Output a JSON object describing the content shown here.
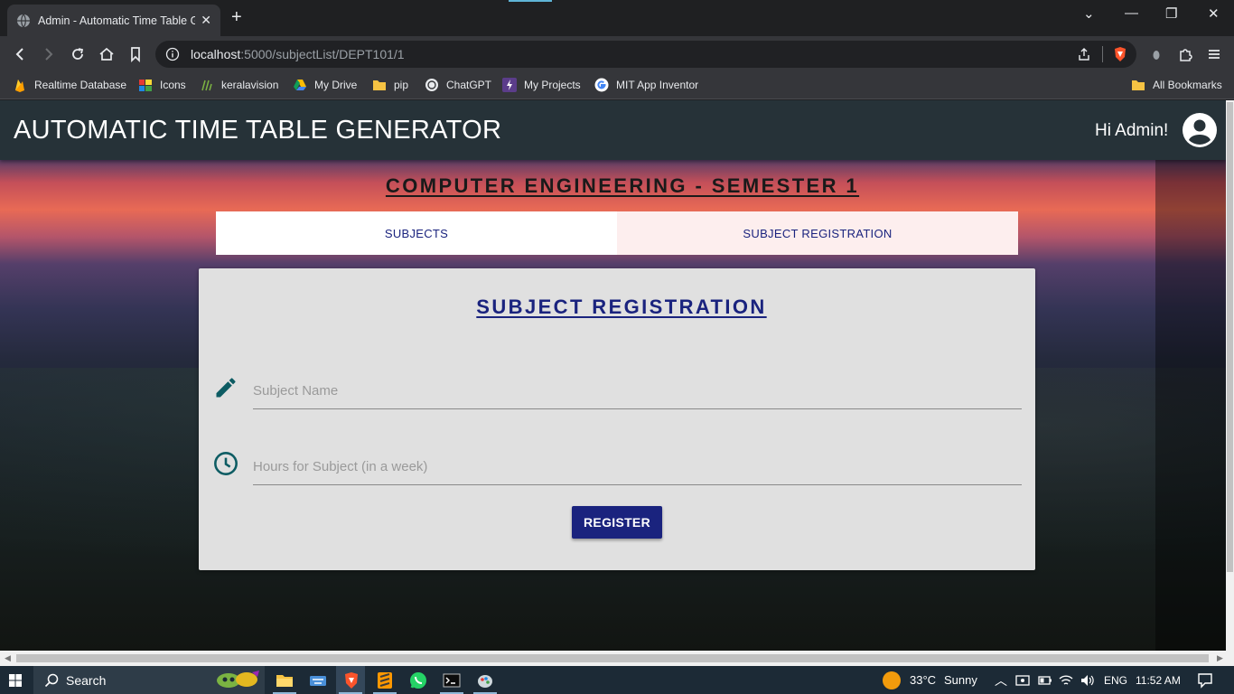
{
  "browser": {
    "tab_title": "Admin - Automatic Time Table G",
    "url_host": "localhost",
    "url_path": ":5000/subjectList/DEPT101/1",
    "bookmarks": [
      {
        "label": "Realtime Database",
        "icon": "firebase-icon"
      },
      {
        "label": "Icons",
        "icon": "icons-site-icon"
      },
      {
        "label": "keralavision",
        "icon": "keralavision-icon"
      },
      {
        "label": "My Drive",
        "icon": "google-drive-icon"
      },
      {
        "label": "pip",
        "icon": "folder-icon"
      },
      {
        "label": "ChatGPT",
        "icon": "chatgpt-icon"
      },
      {
        "label": "My Projects",
        "icon": "projects-icon"
      },
      {
        "label": "MIT App Inventor",
        "icon": "google-icon"
      }
    ],
    "all_bookmarks": "All Bookmarks"
  },
  "app": {
    "title": "AUTOMATIC TIME TABLE GENERATOR",
    "greeting": "Hi Admin!"
  },
  "page": {
    "heading": "COMPUTER ENGINEERING - SEMESTER 1",
    "tabs": [
      {
        "label": "SUBJECTS"
      },
      {
        "label": "SUBJECT REGISTRATION"
      }
    ],
    "form": {
      "title": "SUBJECT REGISTRATION",
      "subject_name_placeholder": "Subject Name",
      "hours_placeholder": "Hours for Subject (in a week)",
      "register_label": "REGISTER"
    }
  },
  "taskbar": {
    "search_label": "Search",
    "weather": "33°C",
    "weather_desc": "Sunny",
    "language": "ENG",
    "time": "11:52 AM"
  },
  "colors": {
    "appbar": "#263238",
    "primary": "#1a237e",
    "icon_teal": "#0d5c63",
    "card": "#e0e0e0"
  }
}
